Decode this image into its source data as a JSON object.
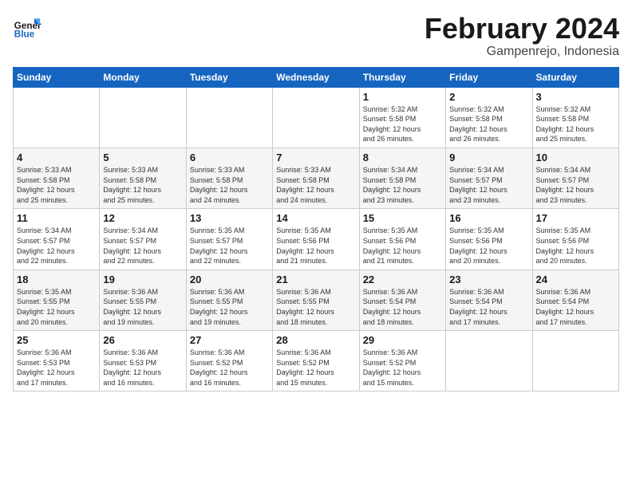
{
  "logo": {
    "text_general": "General",
    "text_blue": "Blue"
  },
  "header": {
    "month": "February 2024",
    "location": "Gampenrejo, Indonesia"
  },
  "weekdays": [
    "Sunday",
    "Monday",
    "Tuesday",
    "Wednesday",
    "Thursday",
    "Friday",
    "Saturday"
  ],
  "weeks": [
    [
      {
        "day": "",
        "info": ""
      },
      {
        "day": "",
        "info": ""
      },
      {
        "day": "",
        "info": ""
      },
      {
        "day": "",
        "info": ""
      },
      {
        "day": "1",
        "info": "Sunrise: 5:32 AM\nSunset: 5:58 PM\nDaylight: 12 hours\nand 26 minutes."
      },
      {
        "day": "2",
        "info": "Sunrise: 5:32 AM\nSunset: 5:58 PM\nDaylight: 12 hours\nand 26 minutes."
      },
      {
        "day": "3",
        "info": "Sunrise: 5:32 AM\nSunset: 5:58 PM\nDaylight: 12 hours\nand 25 minutes."
      }
    ],
    [
      {
        "day": "4",
        "info": "Sunrise: 5:33 AM\nSunset: 5:58 PM\nDaylight: 12 hours\nand 25 minutes."
      },
      {
        "day": "5",
        "info": "Sunrise: 5:33 AM\nSunset: 5:58 PM\nDaylight: 12 hours\nand 25 minutes."
      },
      {
        "day": "6",
        "info": "Sunrise: 5:33 AM\nSunset: 5:58 PM\nDaylight: 12 hours\nand 24 minutes."
      },
      {
        "day": "7",
        "info": "Sunrise: 5:33 AM\nSunset: 5:58 PM\nDaylight: 12 hours\nand 24 minutes."
      },
      {
        "day": "8",
        "info": "Sunrise: 5:34 AM\nSunset: 5:58 PM\nDaylight: 12 hours\nand 23 minutes."
      },
      {
        "day": "9",
        "info": "Sunrise: 5:34 AM\nSunset: 5:57 PM\nDaylight: 12 hours\nand 23 minutes."
      },
      {
        "day": "10",
        "info": "Sunrise: 5:34 AM\nSunset: 5:57 PM\nDaylight: 12 hours\nand 23 minutes."
      }
    ],
    [
      {
        "day": "11",
        "info": "Sunrise: 5:34 AM\nSunset: 5:57 PM\nDaylight: 12 hours\nand 22 minutes."
      },
      {
        "day": "12",
        "info": "Sunrise: 5:34 AM\nSunset: 5:57 PM\nDaylight: 12 hours\nand 22 minutes."
      },
      {
        "day": "13",
        "info": "Sunrise: 5:35 AM\nSunset: 5:57 PM\nDaylight: 12 hours\nand 22 minutes."
      },
      {
        "day": "14",
        "info": "Sunrise: 5:35 AM\nSunset: 5:56 PM\nDaylight: 12 hours\nand 21 minutes."
      },
      {
        "day": "15",
        "info": "Sunrise: 5:35 AM\nSunset: 5:56 PM\nDaylight: 12 hours\nand 21 minutes."
      },
      {
        "day": "16",
        "info": "Sunrise: 5:35 AM\nSunset: 5:56 PM\nDaylight: 12 hours\nand 20 minutes."
      },
      {
        "day": "17",
        "info": "Sunrise: 5:35 AM\nSunset: 5:56 PM\nDaylight: 12 hours\nand 20 minutes."
      }
    ],
    [
      {
        "day": "18",
        "info": "Sunrise: 5:35 AM\nSunset: 5:55 PM\nDaylight: 12 hours\nand 20 minutes."
      },
      {
        "day": "19",
        "info": "Sunrise: 5:36 AM\nSunset: 5:55 PM\nDaylight: 12 hours\nand 19 minutes."
      },
      {
        "day": "20",
        "info": "Sunrise: 5:36 AM\nSunset: 5:55 PM\nDaylight: 12 hours\nand 19 minutes."
      },
      {
        "day": "21",
        "info": "Sunrise: 5:36 AM\nSunset: 5:55 PM\nDaylight: 12 hours\nand 18 minutes."
      },
      {
        "day": "22",
        "info": "Sunrise: 5:36 AM\nSunset: 5:54 PM\nDaylight: 12 hours\nand 18 minutes."
      },
      {
        "day": "23",
        "info": "Sunrise: 5:36 AM\nSunset: 5:54 PM\nDaylight: 12 hours\nand 17 minutes."
      },
      {
        "day": "24",
        "info": "Sunrise: 5:36 AM\nSunset: 5:54 PM\nDaylight: 12 hours\nand 17 minutes."
      }
    ],
    [
      {
        "day": "25",
        "info": "Sunrise: 5:36 AM\nSunset: 5:53 PM\nDaylight: 12 hours\nand 17 minutes."
      },
      {
        "day": "26",
        "info": "Sunrise: 5:36 AM\nSunset: 5:53 PM\nDaylight: 12 hours\nand 16 minutes."
      },
      {
        "day": "27",
        "info": "Sunrise: 5:36 AM\nSunset: 5:52 PM\nDaylight: 12 hours\nand 16 minutes."
      },
      {
        "day": "28",
        "info": "Sunrise: 5:36 AM\nSunset: 5:52 PM\nDaylight: 12 hours\nand 15 minutes."
      },
      {
        "day": "29",
        "info": "Sunrise: 5:36 AM\nSunset: 5:52 PM\nDaylight: 12 hours\nand 15 minutes."
      },
      {
        "day": "",
        "info": ""
      },
      {
        "day": "",
        "info": ""
      }
    ]
  ]
}
